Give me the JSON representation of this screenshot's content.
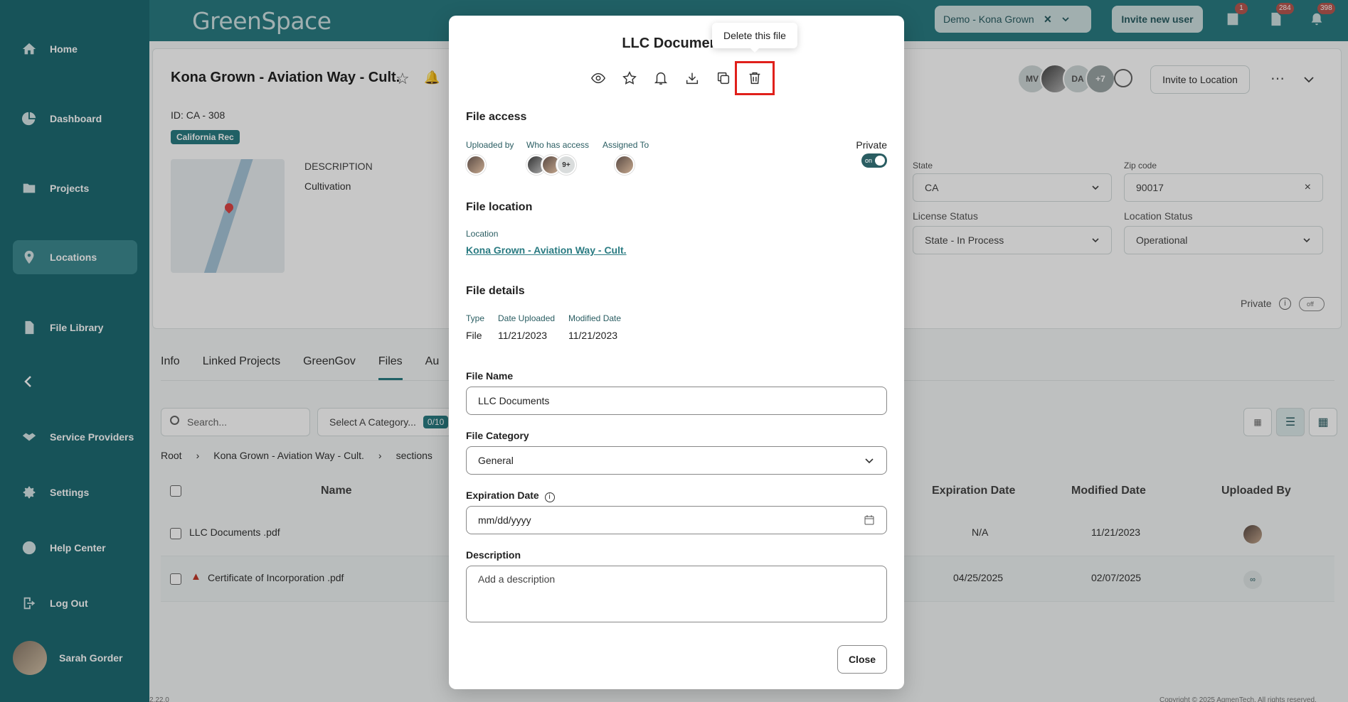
{
  "app": {
    "logo": "GreenSpace",
    "version": "2.22.0",
    "copyright": "Copyright © 2025 AgmenTech. All rights reserved."
  },
  "sidebar": {
    "items": [
      {
        "label": "Home",
        "icon": "home-icon"
      },
      {
        "label": "Dashboard",
        "icon": "pie-chart-icon"
      },
      {
        "label": "Projects",
        "icon": "folder-icon"
      },
      {
        "label": "Locations",
        "icon": "location-pin-icon",
        "active": true
      },
      {
        "label": "File Library",
        "icon": "file-icon"
      },
      {
        "label": "Service Providers",
        "icon": "handshake-icon"
      },
      {
        "label": "Settings",
        "icon": "gear-icon"
      },
      {
        "label": "Help Center",
        "icon": "help-icon"
      },
      {
        "label": "Log Out",
        "icon": "logout-icon"
      }
    ],
    "user_name": "Sarah Gorder"
  },
  "header": {
    "org_selector": "Demo - Kona Grown",
    "invite_label": "Invite new user",
    "badges": {
      "building": "1",
      "docs": "284",
      "notifications": "398"
    }
  },
  "location": {
    "title": "Kona Grown - Aviation Way - Cult.",
    "id": "ID: CA - 308",
    "tag": "California Rec",
    "description_label": "DESCRIPTION",
    "description": "Cultivation",
    "avatars": [
      "MV",
      "",
      "DA",
      "+7"
    ],
    "invite_label": "Invite to Location",
    "state_label": "State",
    "state": "CA",
    "zip_label": "Zip code",
    "zip": "90017",
    "license_status_label": "License Status",
    "license_status": "State - In Process",
    "location_status_label": "Location Status",
    "location_status": "Operational",
    "private_label": "Private",
    "private_toggle": "off"
  },
  "tabs": [
    "Info",
    "Linked Projects",
    "GreenGov",
    "Files",
    "Au"
  ],
  "files": {
    "search_placeholder": "Search...",
    "category_placeholder": "Select A Category...",
    "category_count": "0/10",
    "breadcrumb": [
      "Root",
      "Kona Grown - Aviation Way - Cult.",
      "sections"
    ],
    "columns": {
      "name": "Name",
      "expiration": "Expiration Date",
      "modified": "Modified Date",
      "uploaded_by": "Uploaded By"
    },
    "rows": [
      {
        "name": "LLC Documents .pdf",
        "expiration": "N/A",
        "modified": "11/21/2023"
      },
      {
        "name": "Certificate of Incorporation .pdf",
        "expiration": "04/25/2025",
        "modified": "02/07/2025"
      }
    ]
  },
  "modal": {
    "title": "LLC Documents",
    "tooltip": "Delete this file",
    "file_access_heading": "File access",
    "uploaded_by_label": "Uploaded by",
    "who_has_access_label": "Who has access",
    "access_more": "9+",
    "assigned_to_label": "Assigned To",
    "private_label": "Private",
    "private_toggle": "on",
    "file_location_heading": "File location",
    "location_label": "Location",
    "location_link": "Kona Grown - Aviation Way - Cult.",
    "file_details_heading": "File details",
    "type_label": "Type",
    "type": "File",
    "date_uploaded_label": "Date Uploaded",
    "date_uploaded": "11/21/2023",
    "modified_label": "Modified Date",
    "modified": "11/21/2023",
    "file_name_label": "File Name",
    "file_name": "LLC Documents",
    "file_category_label": "File Category",
    "file_category": "General",
    "expiration_label": "Expiration Date",
    "expiration_placeholder": "mm/dd/yyyy",
    "description_label": "Description",
    "description_placeholder": "Add a description",
    "close_label": "Close"
  }
}
